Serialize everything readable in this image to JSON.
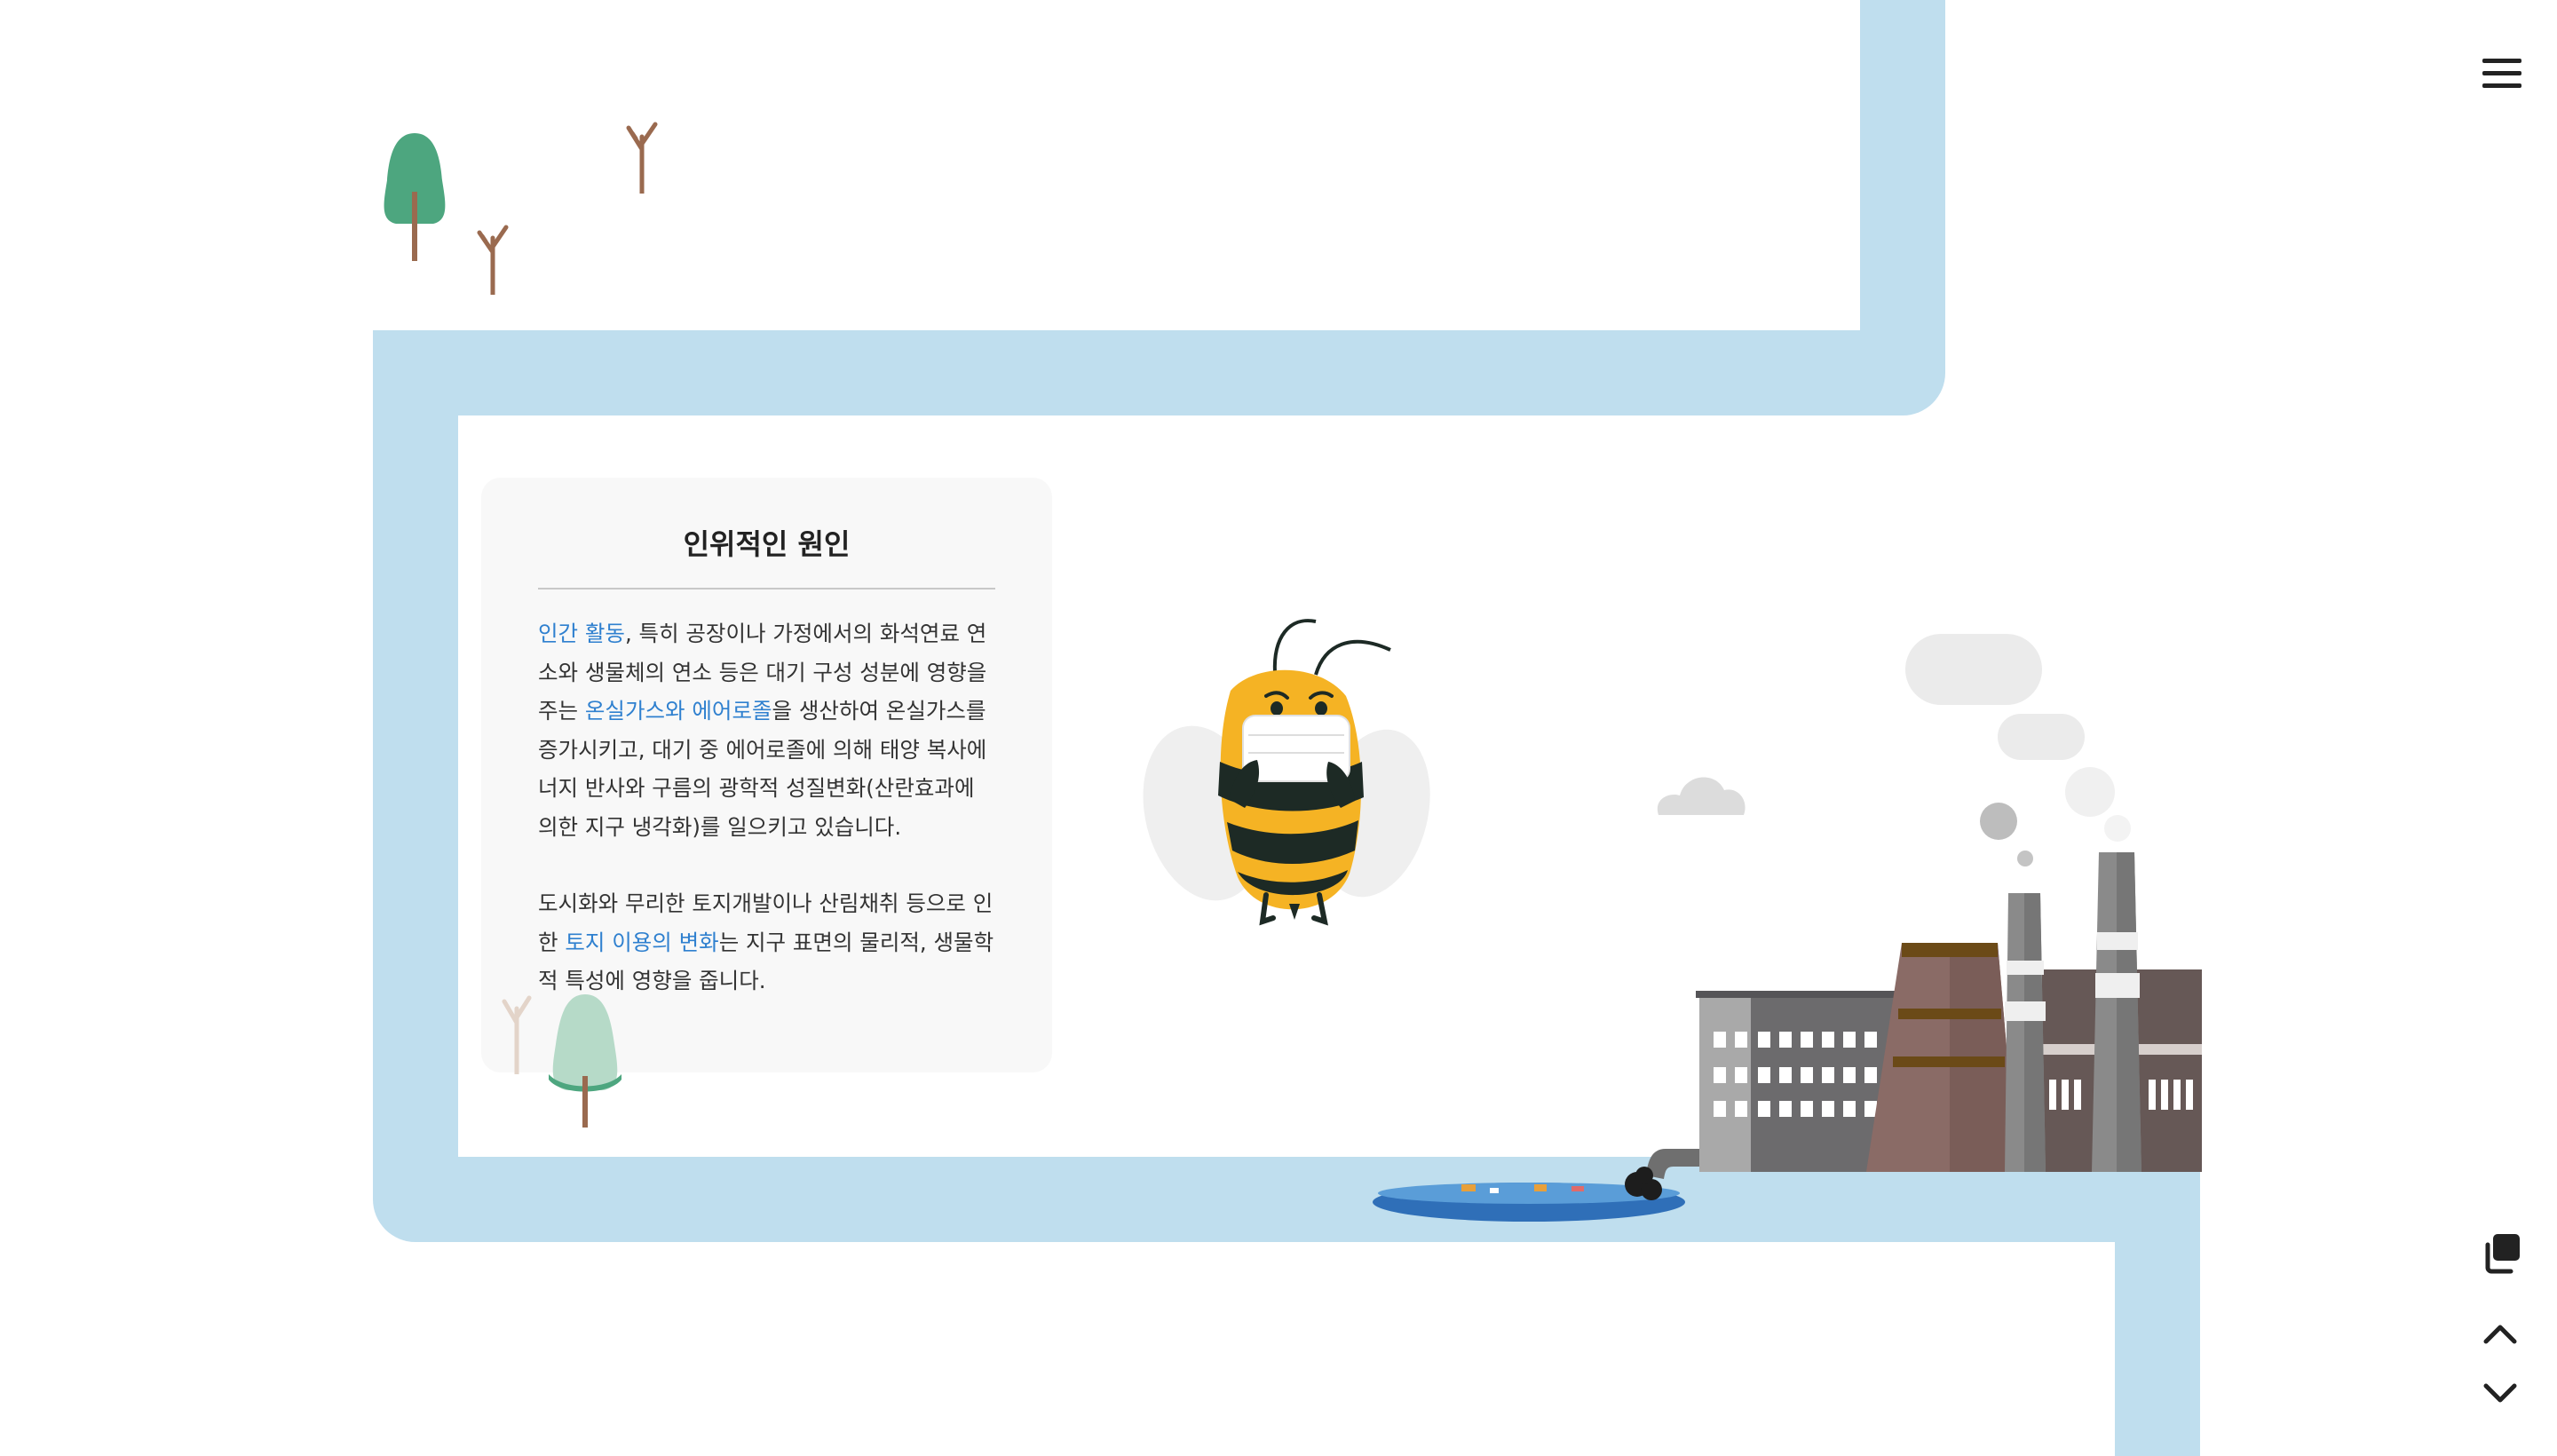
{
  "card": {
    "title": "인위적인 원인",
    "paragraph1": {
      "highlight1": "인간 활동",
      "text1": ", 특히 공장이나 가정에서의 화석연료 연소와 생물체의 연소 등은 대기 구성 성분에 영향을 주는 ",
      "highlight2": "온실가스와 에어로졸",
      "text2": "을 생산하여 온실가스를 증가시키고, 대기 중 에어로졸에 의해 태양 복사에너지 반사와 구름의 광학적 성질변화(산란효과에 의한 지구 냉각화)를 일으키고 있습니다."
    },
    "paragraph2": {
      "text1": "도시화와 무리한 토지개발이나 산림채취 등으로 인한 ",
      "highlight1": "토지 이용의 변화",
      "text2": "는 지구 표면의 물리적, 생물학적 특성에 영향을 줍니다."
    }
  },
  "nav": {
    "menu_icon": "hamburger-menu-icon",
    "copy_icon": "copy-icon",
    "up_icon": "chevron-up-icon",
    "down_icon": "chevron-down-icon"
  },
  "colors": {
    "path": "#bfdeee",
    "highlight": "#2f80cf",
    "bee_yellow": "#f5b324",
    "bee_stripe": "#1d2a25",
    "tree_green": "#4da67f",
    "trunk": "#9a6a4f",
    "factory_gray": "#6c6b6d",
    "factory_brown": "#8a6b66",
    "water": "#2f6fb8"
  }
}
